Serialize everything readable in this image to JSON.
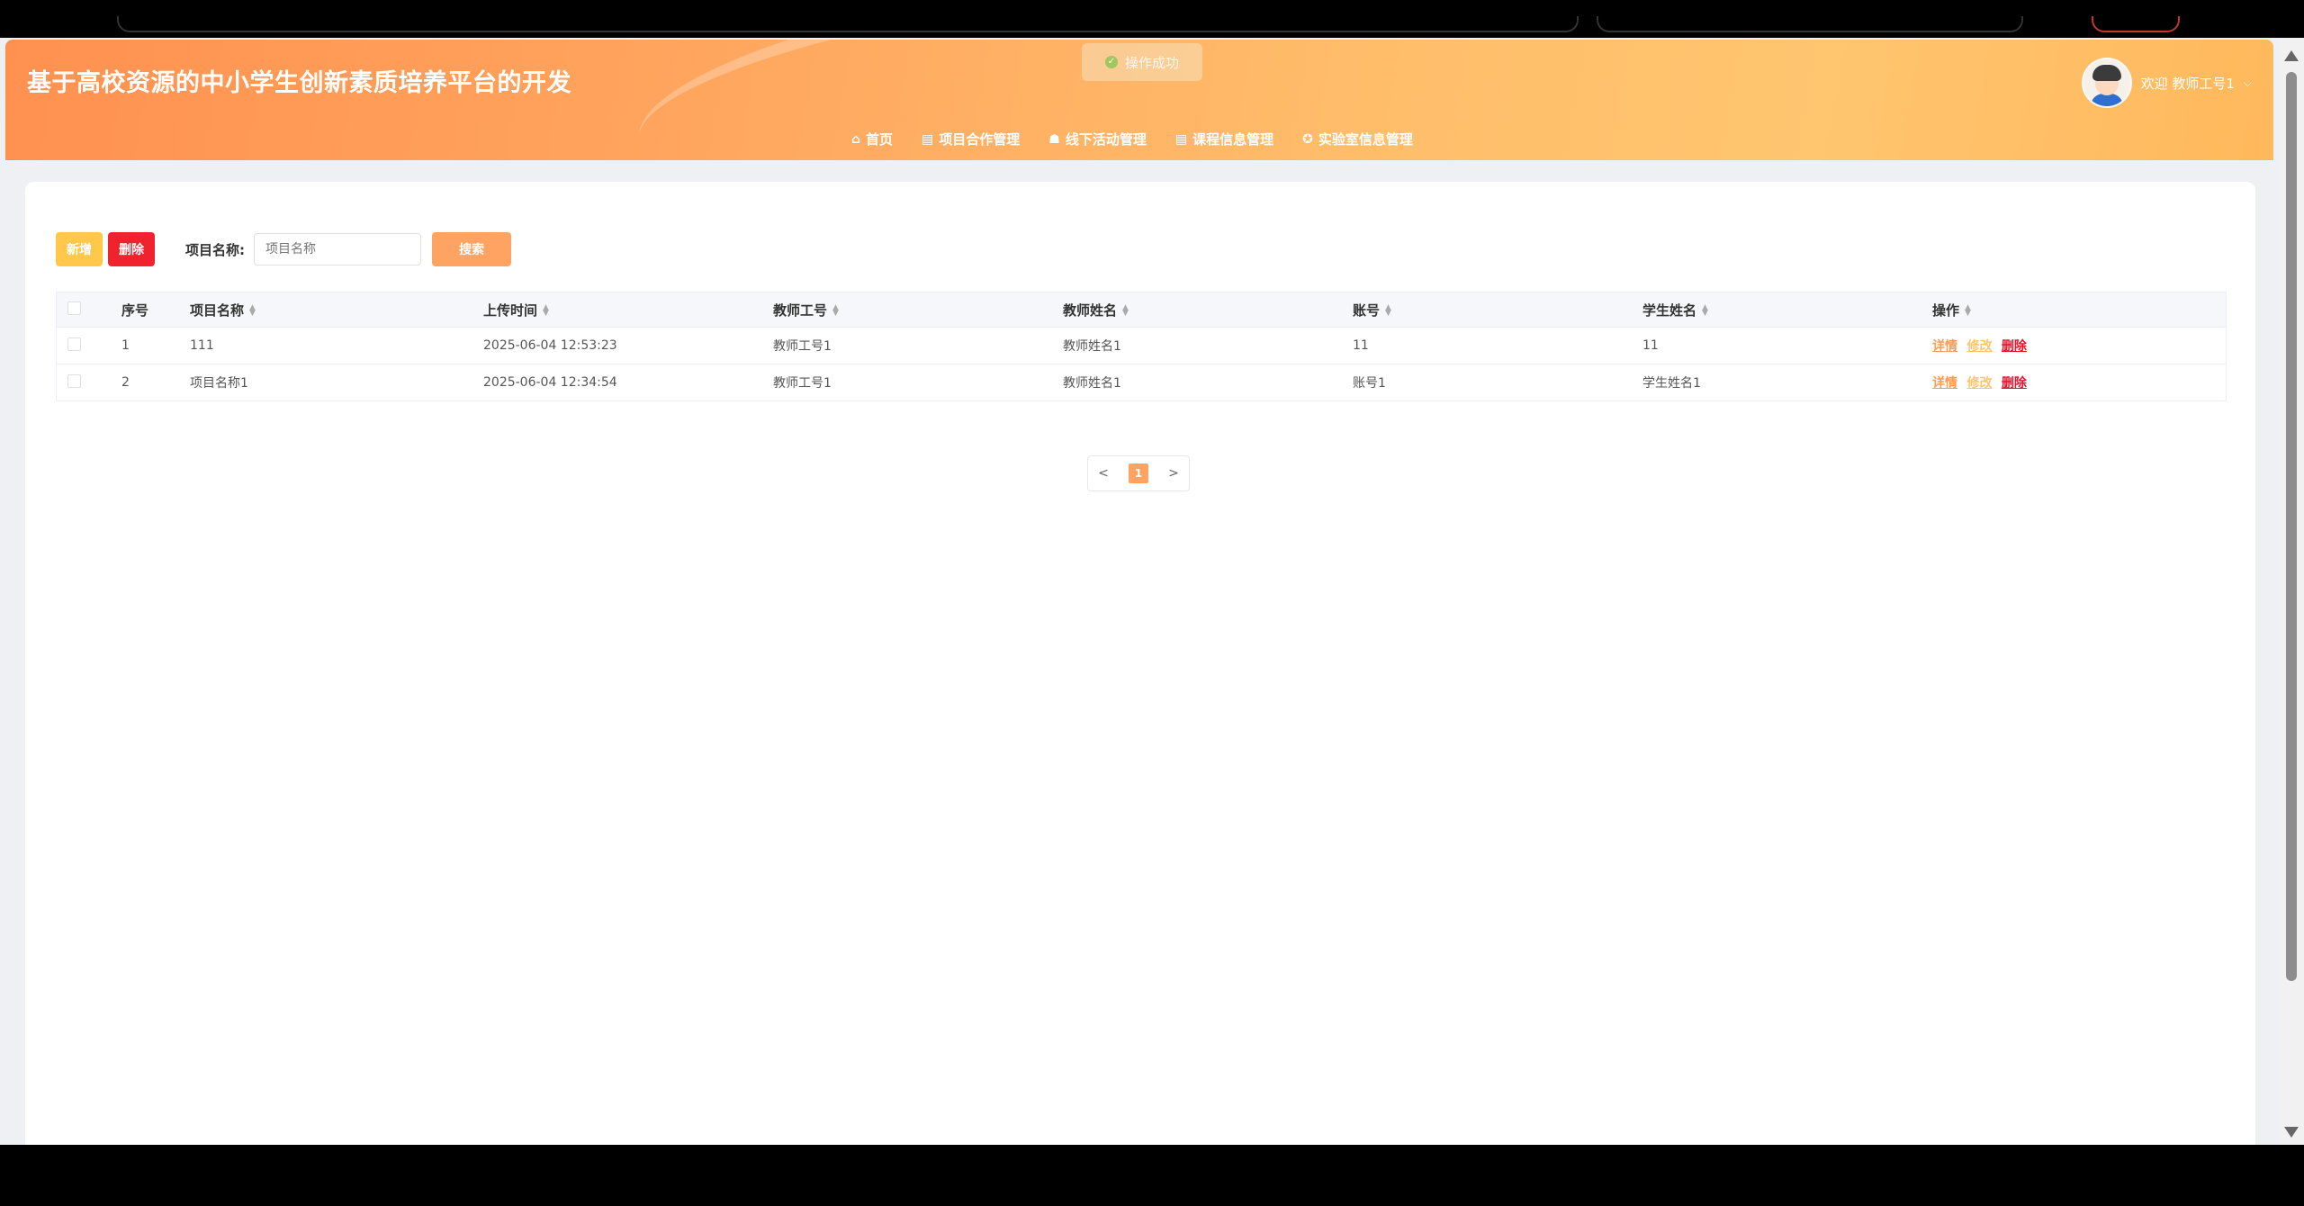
{
  "app": {
    "title": "基于高校资源的中小学生创新素质培养平台的开发",
    "toast": "操作成功",
    "user": {
      "greeting": "欢迎 教师工号1"
    }
  },
  "nav": [
    {
      "label": "首页",
      "icon": "home-icon"
    },
    {
      "label": "项目合作管理",
      "icon": "document-icon"
    },
    {
      "label": "线下活动管理",
      "icon": "folder-icon"
    },
    {
      "label": "课程信息管理",
      "icon": "document-icon"
    },
    {
      "label": "实验室信息管理",
      "icon": "gear-circle-icon"
    }
  ],
  "toolbar": {
    "add_label": "新增",
    "delete_label": "删除",
    "search_label": "项目名称:",
    "search_placeholder": "项目名称",
    "search_button": "搜索"
  },
  "table": {
    "headers": [
      "序号",
      "项目名称",
      "上传时间",
      "教师工号",
      "教师姓名",
      "账号",
      "学生姓名",
      "操作"
    ],
    "rows": [
      {
        "index": "1",
        "name": "111",
        "time": "2025-06-04 12:53:23",
        "teacher_id": "教师工号1",
        "teacher_name": "教师姓名1",
        "account": "11",
        "student_name": "11"
      },
      {
        "index": "2",
        "name": "项目名称1",
        "time": "2025-06-04 12:34:54",
        "teacher_id": "教师工号1",
        "teacher_name": "教师姓名1",
        "account": "账号1",
        "student_name": "学生姓名1"
      }
    ],
    "actions": {
      "detail": "详情",
      "edit": "修改",
      "delete": "删除"
    }
  },
  "pagination": {
    "prev": "<",
    "current": "1",
    "next": ">"
  },
  "colors": {
    "header_start": "#ff9150",
    "header_end": "#ffc56f",
    "add_button": "#ffc84a",
    "delete_button": "#f0222e",
    "search_button": "#ffa363",
    "link_detail": "#ff9b52",
    "link_edit": "#ffc56b",
    "link_delete": "#e8132c"
  }
}
